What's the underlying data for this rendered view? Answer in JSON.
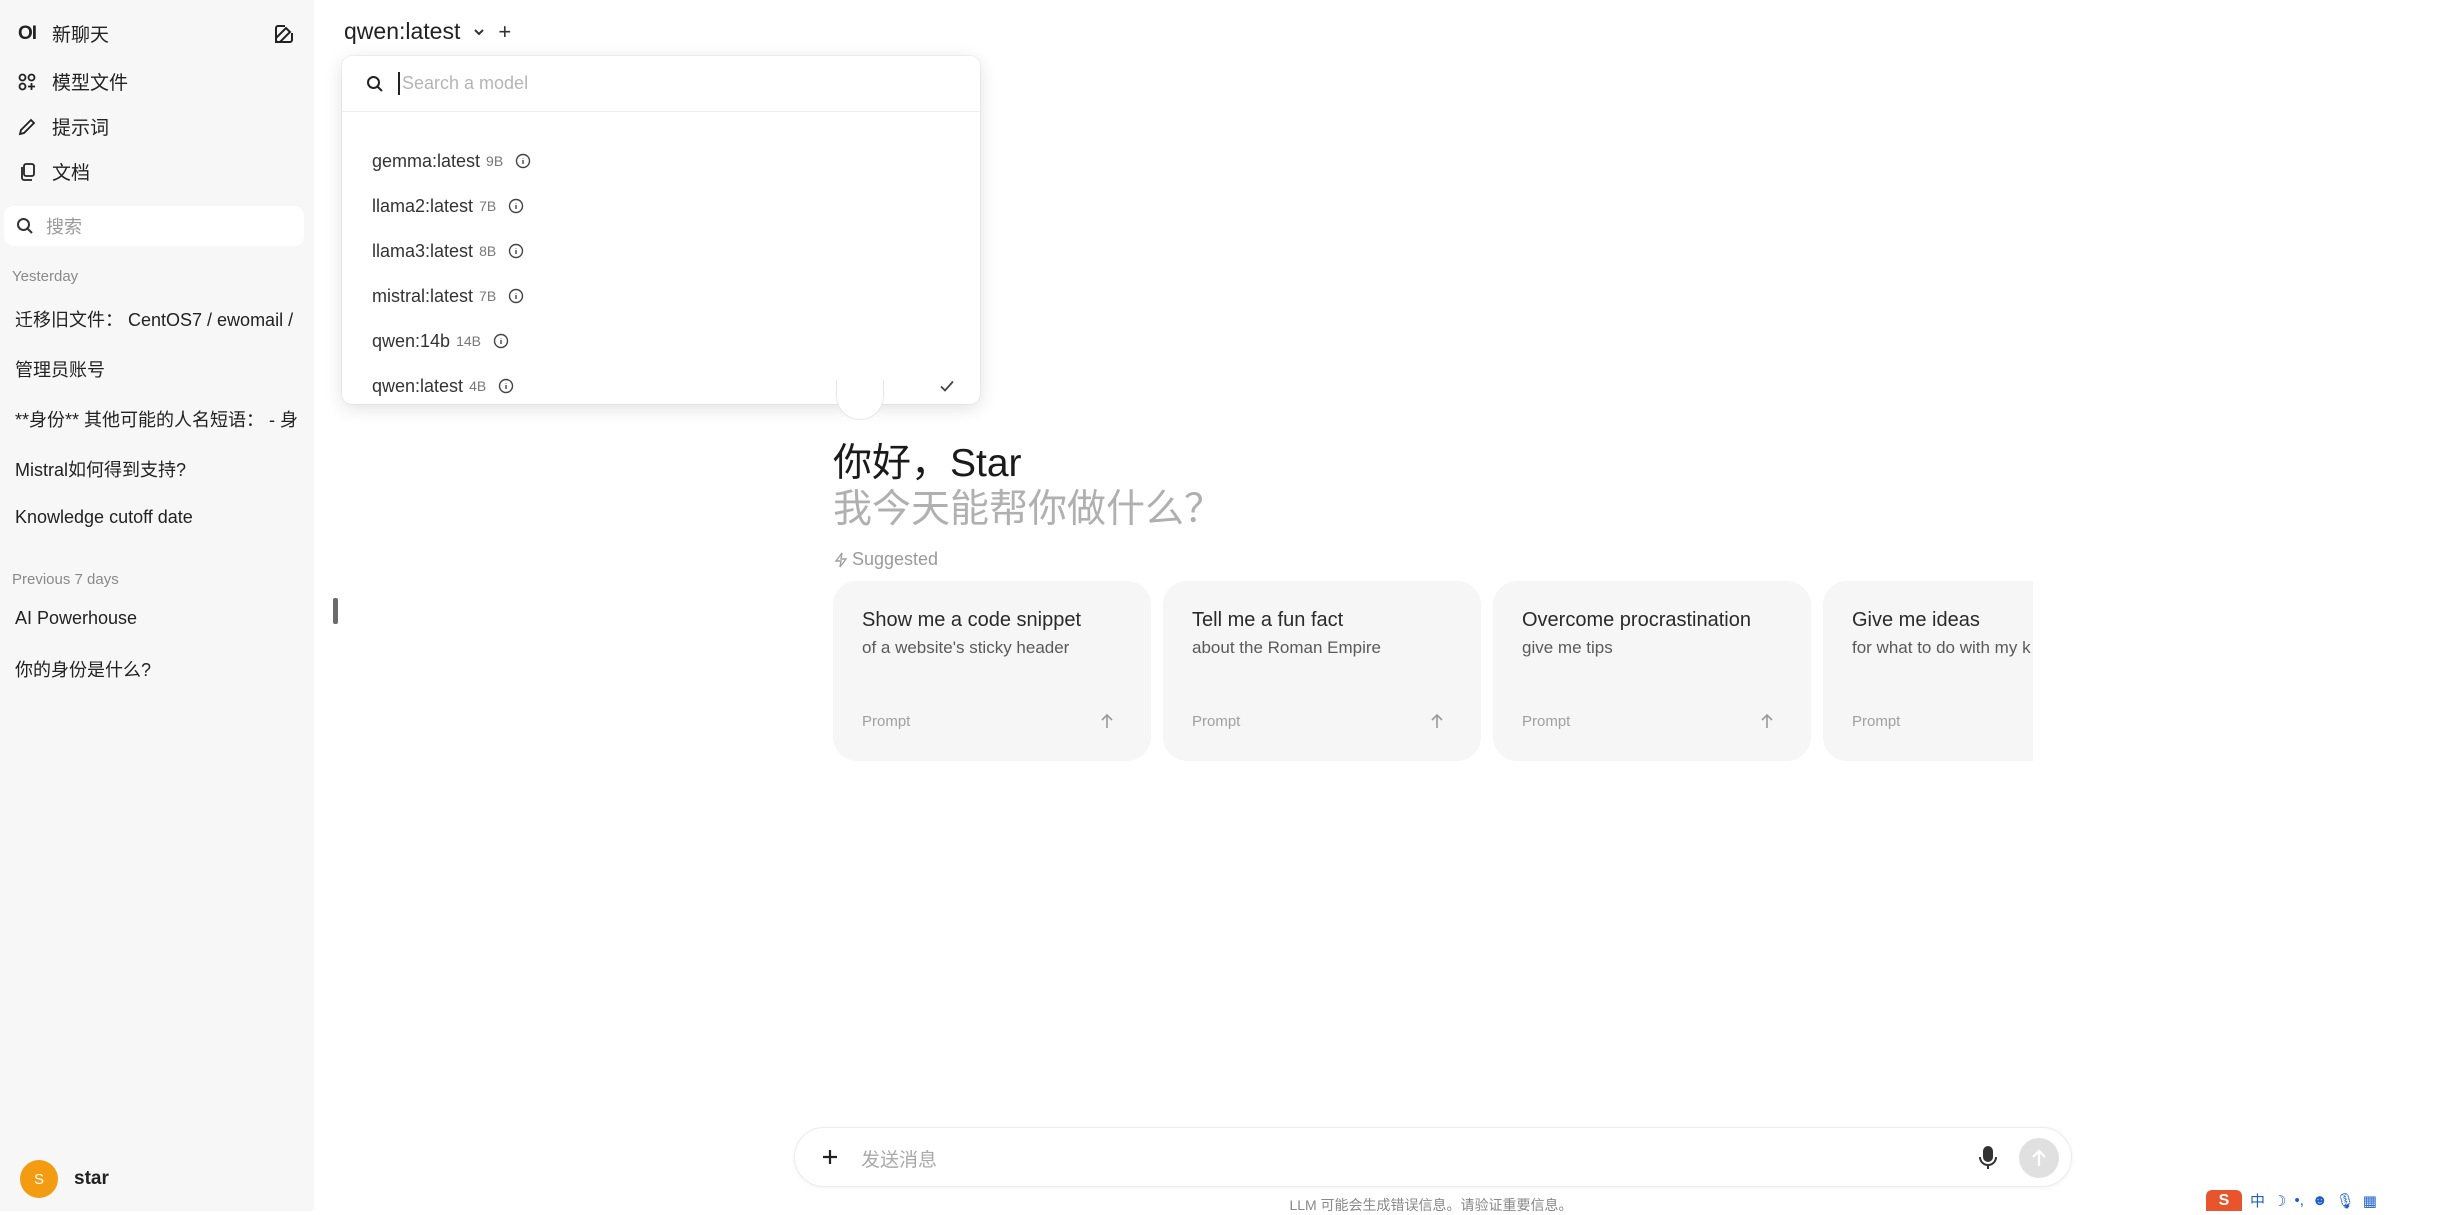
{
  "sidebar": {
    "logo": "OI",
    "new_chat": "新聊天",
    "nav": [
      {
        "label": "模型文件",
        "icon": "apps-icon"
      },
      {
        "label": "提示词",
        "icon": "pencil-icon"
      },
      {
        "label": "文档",
        "icon": "documents-icon"
      }
    ],
    "search_placeholder": "搜索",
    "sections": [
      {
        "label": "Yesterday",
        "items": [
          "迁移旧文件： CentOS7 / ewomail /",
          "管理员账号",
          "**身份** 其他可能的人名短语：  - 身",
          "Mistral如何得到支持?",
          "Knowledge cutoff date"
        ]
      },
      {
        "label": "Previous 7 days",
        "items": [
          "AI Powerhouse",
          "你的身份是什么?"
        ]
      }
    ],
    "user": {
      "initial": "S",
      "name": "star",
      "avatar_color": "#f39c12"
    }
  },
  "header": {
    "model": "qwen:latest"
  },
  "model_dropdown": {
    "search_placeholder": "Search a model",
    "models": [
      {
        "name": "gemma:latest",
        "size": "9B",
        "selected": false
      },
      {
        "name": "llama2:latest",
        "size": "7B",
        "selected": false
      },
      {
        "name": "llama3:latest",
        "size": "8B",
        "selected": false
      },
      {
        "name": "mistral:latest",
        "size": "7B",
        "selected": false
      },
      {
        "name": "qwen:14b",
        "size": "14B",
        "selected": false
      },
      {
        "name": "qwen:latest",
        "size": "4B",
        "selected": true
      }
    ]
  },
  "greeting": {
    "title": "你好，Star",
    "subtitle": "我今天能帮你做什么？",
    "suggested_label": "Suggested"
  },
  "suggestions": [
    {
      "title": "Show me a code snippet",
      "sub": "of a website's sticky header",
      "prompt": "Prompt"
    },
    {
      "title": "Tell me a fun fact",
      "sub": "about the Roman Empire",
      "prompt": "Prompt"
    },
    {
      "title": "Overcome procrastination",
      "sub": "give me tips",
      "prompt": "Prompt"
    },
    {
      "title": "Give me ideas",
      "sub": "for what to do with my k",
      "prompt": "Prompt"
    }
  ],
  "composer": {
    "placeholder": "发送消息",
    "disclaimer": "LLM 可能会生成错误信息。请验证重要信息。"
  },
  "ime_tray": {
    "logo": "S",
    "lang": "中"
  },
  "colors": {
    "sidebar_bg": "#f7f7f7",
    "card_bg": "#f6f6f6",
    "avatar": "#f39c12"
  }
}
